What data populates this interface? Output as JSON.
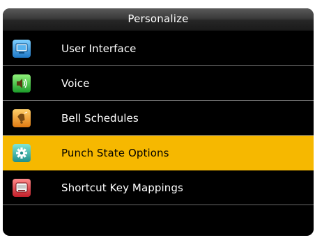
{
  "title": "Personalize",
  "menu": {
    "items": [
      {
        "label": "User Interface",
        "icon": "monitor-icon"
      },
      {
        "label": "Voice",
        "icon": "speaker-icon"
      },
      {
        "label": "Bell Schedules",
        "icon": "bell-icon"
      },
      {
        "label": "Punch State Options",
        "icon": "gear-icon",
        "selected": true
      },
      {
        "label": "Shortcut Key Mappings",
        "icon": "keyboard-key-icon"
      }
    ]
  },
  "colors": {
    "background": "#000000",
    "selected_row": "#f6b800",
    "divider": "#6a6a6a"
  }
}
